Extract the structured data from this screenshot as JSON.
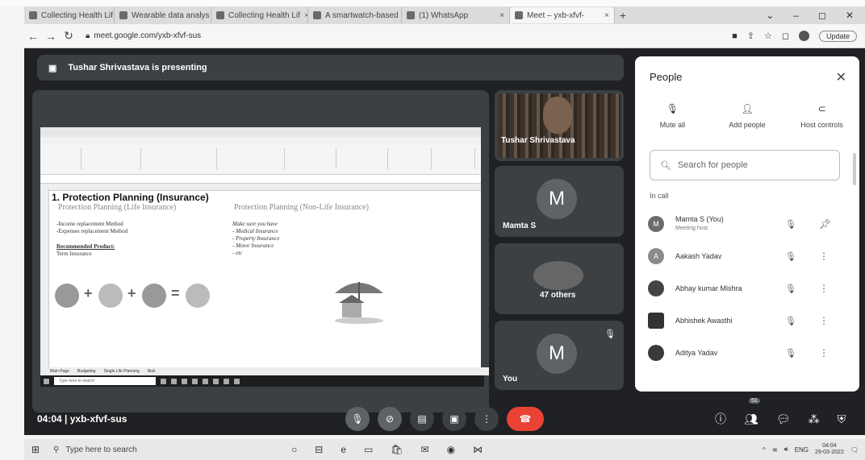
{
  "browser": {
    "tabs": [
      {
        "label": "Collecting Health Lif"
      },
      {
        "label": "Wearable data analys"
      },
      {
        "label": "Collecting Health Lif"
      },
      {
        "label": "A smartwatch-based"
      },
      {
        "label": "(1) WhatsApp"
      },
      {
        "label": "Meet – yxb-xfvf-"
      }
    ],
    "new_tab": "+",
    "url": "meet.google.com/yxb-xfvf-sus",
    "update_label": "Update"
  },
  "meet": {
    "presenter_banner": "Tushar Shrivastava is presenting",
    "slide": {
      "heading": "1. Protection Planning (Insurance)",
      "left_sub": "Protection Planning (Life Insurance)",
      "right_sub": "Protection Planning (Non-Life Insurance)",
      "left_items": [
        "-Income replacement Method",
        "-Expenses replacement Method"
      ],
      "recommended_title": "Recommended Product:",
      "recommended_value": "Term Insurance",
      "right_items": [
        "Make sure you have",
        "- Medical Insurance",
        "- Property Insurance",
        "- Motor Insurance",
        "- etc"
      ],
      "sheet_tabs": [
        "Main Page",
        "Budgeting",
        "Single Life Planning",
        "Risk"
      ],
      "taskbar_search": "Type here to search"
    },
    "tiles": [
      {
        "name": "Tushar Shrivastava"
      },
      {
        "name": "Mamta S",
        "initial": "M"
      },
      {
        "name": "47 others"
      },
      {
        "name": "You",
        "initial": "M"
      }
    ],
    "meeting_info": "04:04  |  yxb-xfvf-sus",
    "participant_badge": "51"
  },
  "people_panel": {
    "title": "People",
    "actions": [
      {
        "label": "Mute all",
        "icon": "mic-off-icon"
      },
      {
        "label": "Add people",
        "icon": "add-person-icon"
      },
      {
        "label": "Host controls",
        "icon": "toggle-icon"
      }
    ],
    "search_placeholder": "Search for people",
    "section": "In call",
    "participants": [
      {
        "name": "Mamta S (You)",
        "role": "Meeting host",
        "initial": "M"
      },
      {
        "name": "Aakash Yadav",
        "role": "",
        "initial": "A"
      },
      {
        "name": "Abhay kumar Mishra",
        "role": "",
        "initial": ""
      },
      {
        "name": "Abhishek Awasthi",
        "role": "",
        "initial": ""
      },
      {
        "name": "Aditya Yadav",
        "role": "",
        "initial": ""
      }
    ]
  },
  "taskbar": {
    "search_placeholder": "Type here to search",
    "time": "04:04",
    "date": "29-03-2022",
    "lang": "ENG"
  }
}
